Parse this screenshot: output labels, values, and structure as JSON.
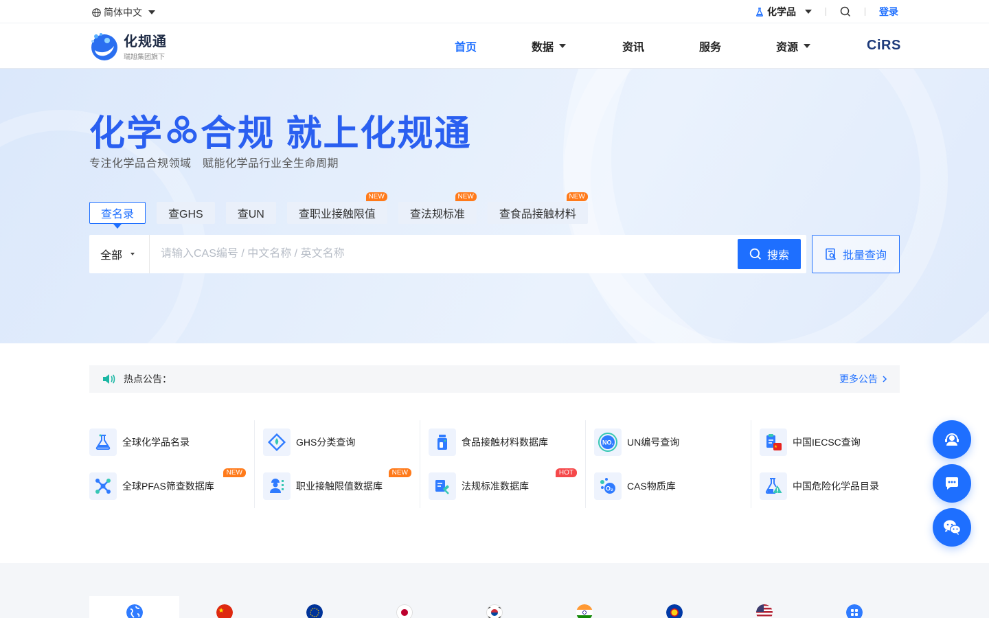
{
  "topbar": {
    "language": "简体中文",
    "category": "化学品",
    "login": "登录"
  },
  "logo": {
    "title": "化规通",
    "subtitle": "瑞旭集团旗下"
  },
  "nav": {
    "items": [
      {
        "label": "首页",
        "active": true,
        "dropdown": false
      },
      {
        "label": "数据",
        "active": false,
        "dropdown": true
      },
      {
        "label": "资讯",
        "active": false,
        "dropdown": false
      },
      {
        "label": "服务",
        "active": false,
        "dropdown": false
      },
      {
        "label": "资源",
        "active": false,
        "dropdown": true
      }
    ],
    "partner": "CiRS"
  },
  "hero": {
    "title_part1": "化学",
    "title_part2": "合规 就上化规通",
    "subtitle": "专注化学品合规领域　赋能化学品行业全生命周期",
    "tabs": [
      {
        "label": "查名录",
        "badge": ""
      },
      {
        "label": "查GHS",
        "badge": ""
      },
      {
        "label": "查UN",
        "badge": ""
      },
      {
        "label": "查职业接触限值",
        "badge": "NEW"
      },
      {
        "label": "查法规标准",
        "badge": "NEW"
      },
      {
        "label": "查食品接触材料",
        "badge": "NEW"
      }
    ],
    "search": {
      "scope": "全部",
      "placeholder": "请输入CAS编号 / 中文名称 / 英文名称",
      "button": "搜索",
      "batch": "批量查询"
    }
  },
  "announce": {
    "label": "热点公告：",
    "more": "更多公告"
  },
  "quick_links": {
    "col1": [
      {
        "label": "全球化学品名录",
        "badge": ""
      },
      {
        "label": "全球PFAS筛查数据库",
        "badge": "NEW"
      }
    ],
    "col2": [
      {
        "label": "GHS分类查询",
        "badge": ""
      },
      {
        "label": "职业接触限值数据库",
        "badge": "NEW"
      }
    ],
    "col3": [
      {
        "label": "食品接触材料数据库",
        "badge": ""
      },
      {
        "label": "法规标准数据库",
        "badge": "HOT"
      }
    ],
    "col4": [
      {
        "label": "UN编号查询",
        "badge": ""
      },
      {
        "label": "CAS物质库",
        "badge": ""
      }
    ],
    "col5": [
      {
        "label": "中国IECSC查询",
        "badge": ""
      },
      {
        "label": "中国危险化学品目录",
        "badge": ""
      }
    ]
  },
  "colors": {
    "brand_blue": "#1e6fff",
    "badge_new": "#ff7a1a",
    "badge_hot": "#f5484a"
  }
}
